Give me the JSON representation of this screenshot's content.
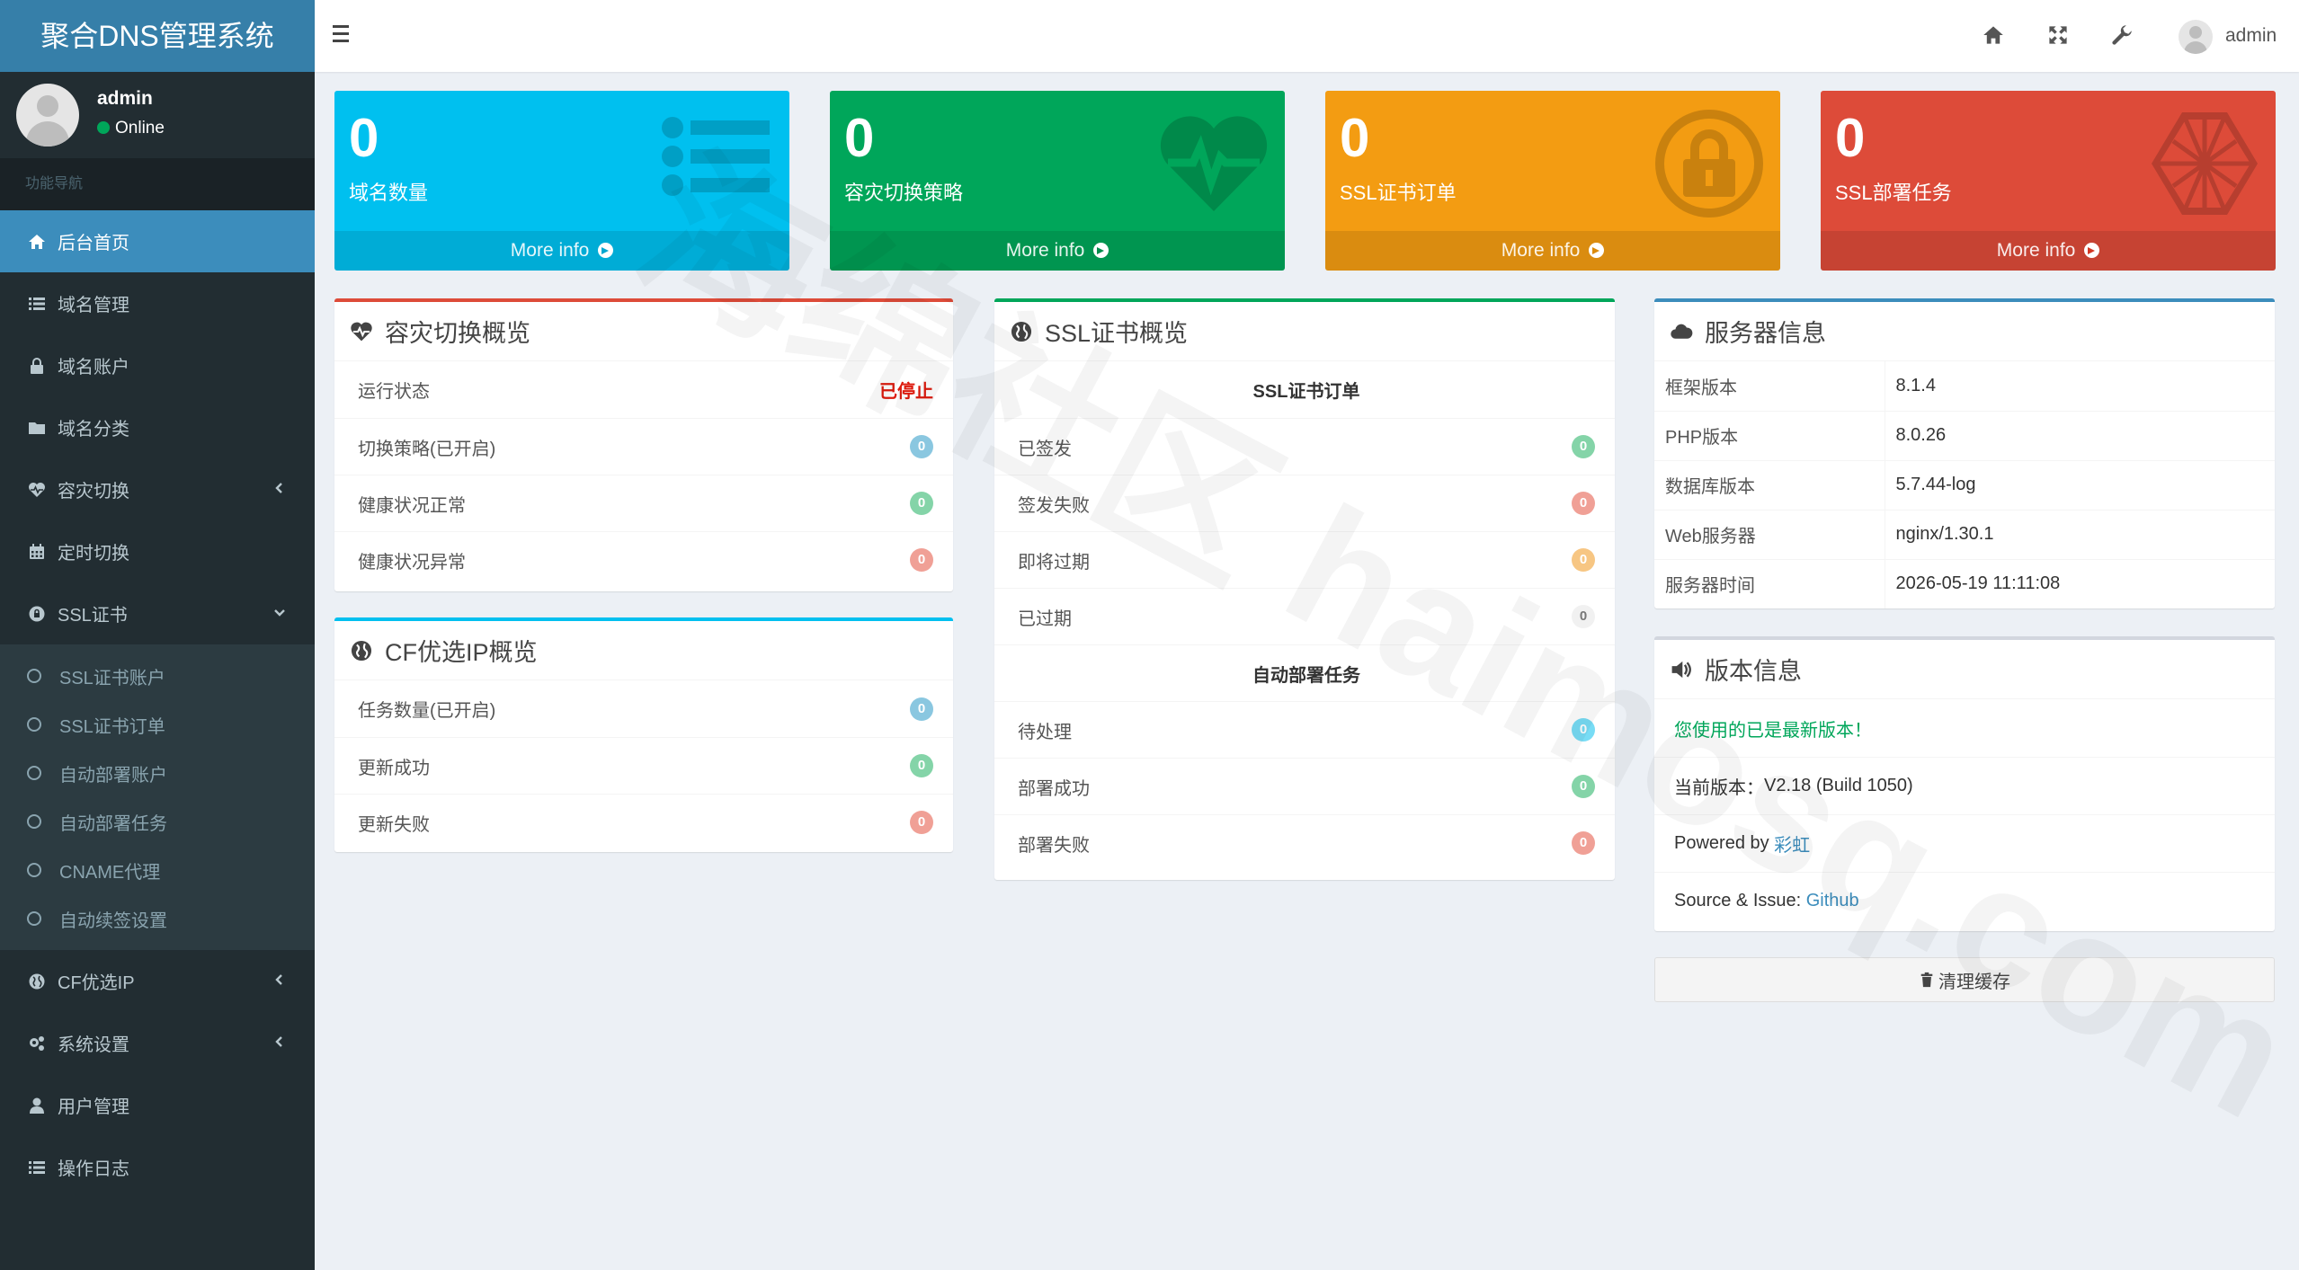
{
  "app": {
    "title": "聚合DNS管理系统"
  },
  "user": {
    "name": "admin",
    "status": "Online"
  },
  "sidebar": {
    "header": "功能导航",
    "items": [
      {
        "label": "后台首页",
        "icon": "home-icon",
        "active": true
      },
      {
        "label": "域名管理",
        "icon": "list-icon"
      },
      {
        "label": "域名账户",
        "icon": "lock-icon"
      },
      {
        "label": "域名分类",
        "icon": "folder-icon"
      },
      {
        "label": "容灾切换",
        "icon": "heartbeat-icon",
        "chevron": "left"
      },
      {
        "label": "定时切换",
        "icon": "calendar-icon"
      },
      {
        "label": "SSL证书",
        "icon": "cert-icon",
        "chevron": "down"
      },
      {
        "label": "CF优选IP",
        "icon": "globe-icon",
        "chevron": "left"
      },
      {
        "label": "系统设置",
        "icon": "cogs-icon",
        "chevron": "left"
      },
      {
        "label": "用户管理",
        "icon": "user-icon"
      },
      {
        "label": "操作日志",
        "icon": "list-icon"
      }
    ],
    "ssl_submenu": [
      "SSL证书账户",
      "SSL证书订单",
      "自动部署账户",
      "自动部署任务",
      "CNAME代理",
      "自动续签设置"
    ]
  },
  "topbar": {
    "user_name": "admin",
    "icons": [
      "home-icon",
      "fullscreen-icon",
      "wrench-icon"
    ]
  },
  "stats": [
    {
      "value": "0",
      "label": "域名数量",
      "more": "More info",
      "color": "#00c0ef",
      "icon": "list-icon"
    },
    {
      "value": "0",
      "label": "容灾切换策略",
      "more": "More info",
      "color": "#00a65a",
      "icon": "heartbeat-icon"
    },
    {
      "value": "0",
      "label": "SSL证书订单",
      "more": "More info",
      "color": "#f39c12",
      "icon": "lock-icon"
    },
    {
      "value": "0",
      "label": "SSL部署任务",
      "more": "More info",
      "color": "#dd4b39",
      "icon": "cube-icon"
    }
  ],
  "failover": {
    "title": "容灾切换概览",
    "rows": [
      {
        "label": "运行状态",
        "value": "已停止"
      },
      {
        "label": "切换策略(已开启)",
        "value": "0"
      },
      {
        "label": "健康状况正常",
        "value": "0"
      },
      {
        "label": "健康状况异常",
        "value": "0"
      }
    ]
  },
  "cf": {
    "title": "CF优选IP概览",
    "rows": [
      {
        "label": "任务数量(已开启)",
        "value": "0"
      },
      {
        "label": "更新成功",
        "value": "0"
      },
      {
        "label": "更新失败",
        "value": "0"
      }
    ]
  },
  "ssl": {
    "title": "SSL证书概览",
    "section1": "SSL证书订单",
    "rows1": [
      {
        "label": "已签发",
        "value": "0"
      },
      {
        "label": "签发失败",
        "value": "0"
      },
      {
        "label": "即将过期",
        "value": "0"
      },
      {
        "label": "已过期",
        "value": "0"
      }
    ],
    "section2": "自动部署任务",
    "rows2": [
      {
        "label": "待处理",
        "value": "0"
      },
      {
        "label": "部署成功",
        "value": "0"
      },
      {
        "label": "部署失败",
        "value": "0"
      }
    ]
  },
  "server": {
    "title": "服务器信息",
    "rows": [
      {
        "k": "框架版本",
        "v": "8.1.4"
      },
      {
        "k": "PHP版本",
        "v": "8.0.26"
      },
      {
        "k": "数据库版本",
        "v": "5.7.44-log"
      },
      {
        "k": "Web服务器",
        "v": "nginx/1.30.1"
      },
      {
        "k": "服务器时间",
        "v": "2026-05-19 11:11:08"
      }
    ]
  },
  "version": {
    "title": "版本信息",
    "latest": "您使用的已是最新版本！",
    "current_label": "当前版本：",
    "current_value": "V2.18 (Build 1050)",
    "powered_label": "Powered by ",
    "powered_link": "彩虹",
    "source_label": "Source & Issue: ",
    "source_link": "Github"
  },
  "clear_cache": "清理缓存",
  "watermark": "海绵社区 haimosq.com"
}
